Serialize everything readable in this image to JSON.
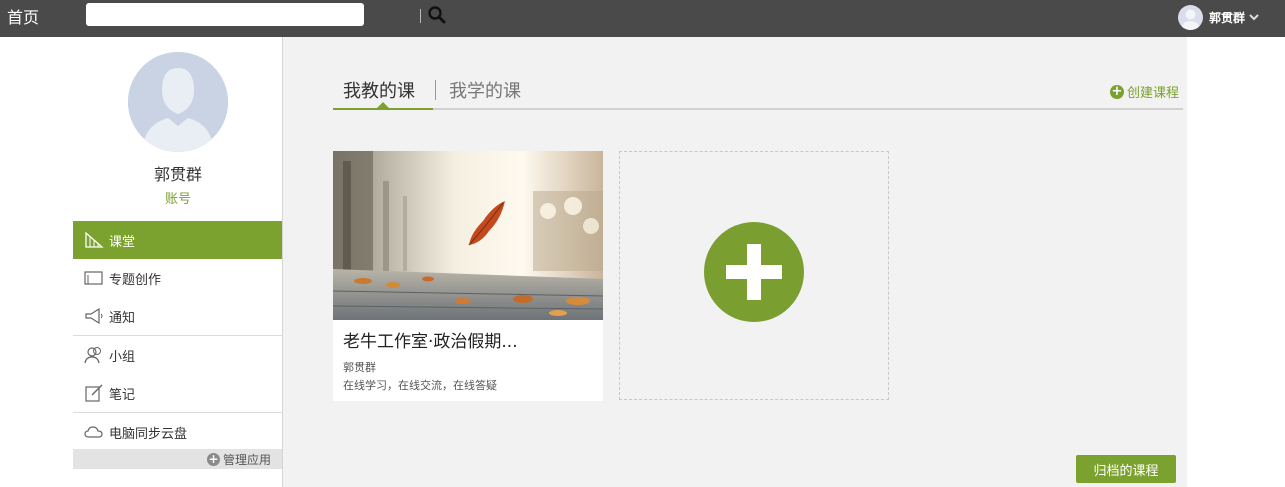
{
  "topbar": {
    "home_label": "首页",
    "search_placeholder": "",
    "user_name": "郭贯群"
  },
  "sidebar": {
    "profile_name": "郭贯群",
    "account_label": "账号",
    "items": [
      {
        "label": "课堂",
        "icon": "classroom-icon"
      },
      {
        "label": "专题创作",
        "icon": "topic-icon"
      },
      {
        "label": "通知",
        "icon": "megaphone-icon"
      },
      {
        "label": "小组",
        "icon": "group-icon"
      },
      {
        "label": "笔记",
        "icon": "note-icon"
      },
      {
        "label": "电脑同步云盘",
        "icon": "cloud-icon"
      }
    ],
    "manage_label": "管理应用"
  },
  "main": {
    "tabs": [
      {
        "label": "我教的课",
        "active": true
      },
      {
        "label": "我学的课",
        "active": false
      }
    ],
    "create_label": "创建课程",
    "course": {
      "title": "老牛工作室·政治假期...",
      "teacher": "郭贯群",
      "description": "在线学习，在线交流，在线答疑"
    },
    "archived_label": "归档的课程"
  },
  "colors": {
    "accent": "#7ba12f",
    "topbar": "#4a4a4a",
    "main_bg": "#f2f2f2"
  }
}
